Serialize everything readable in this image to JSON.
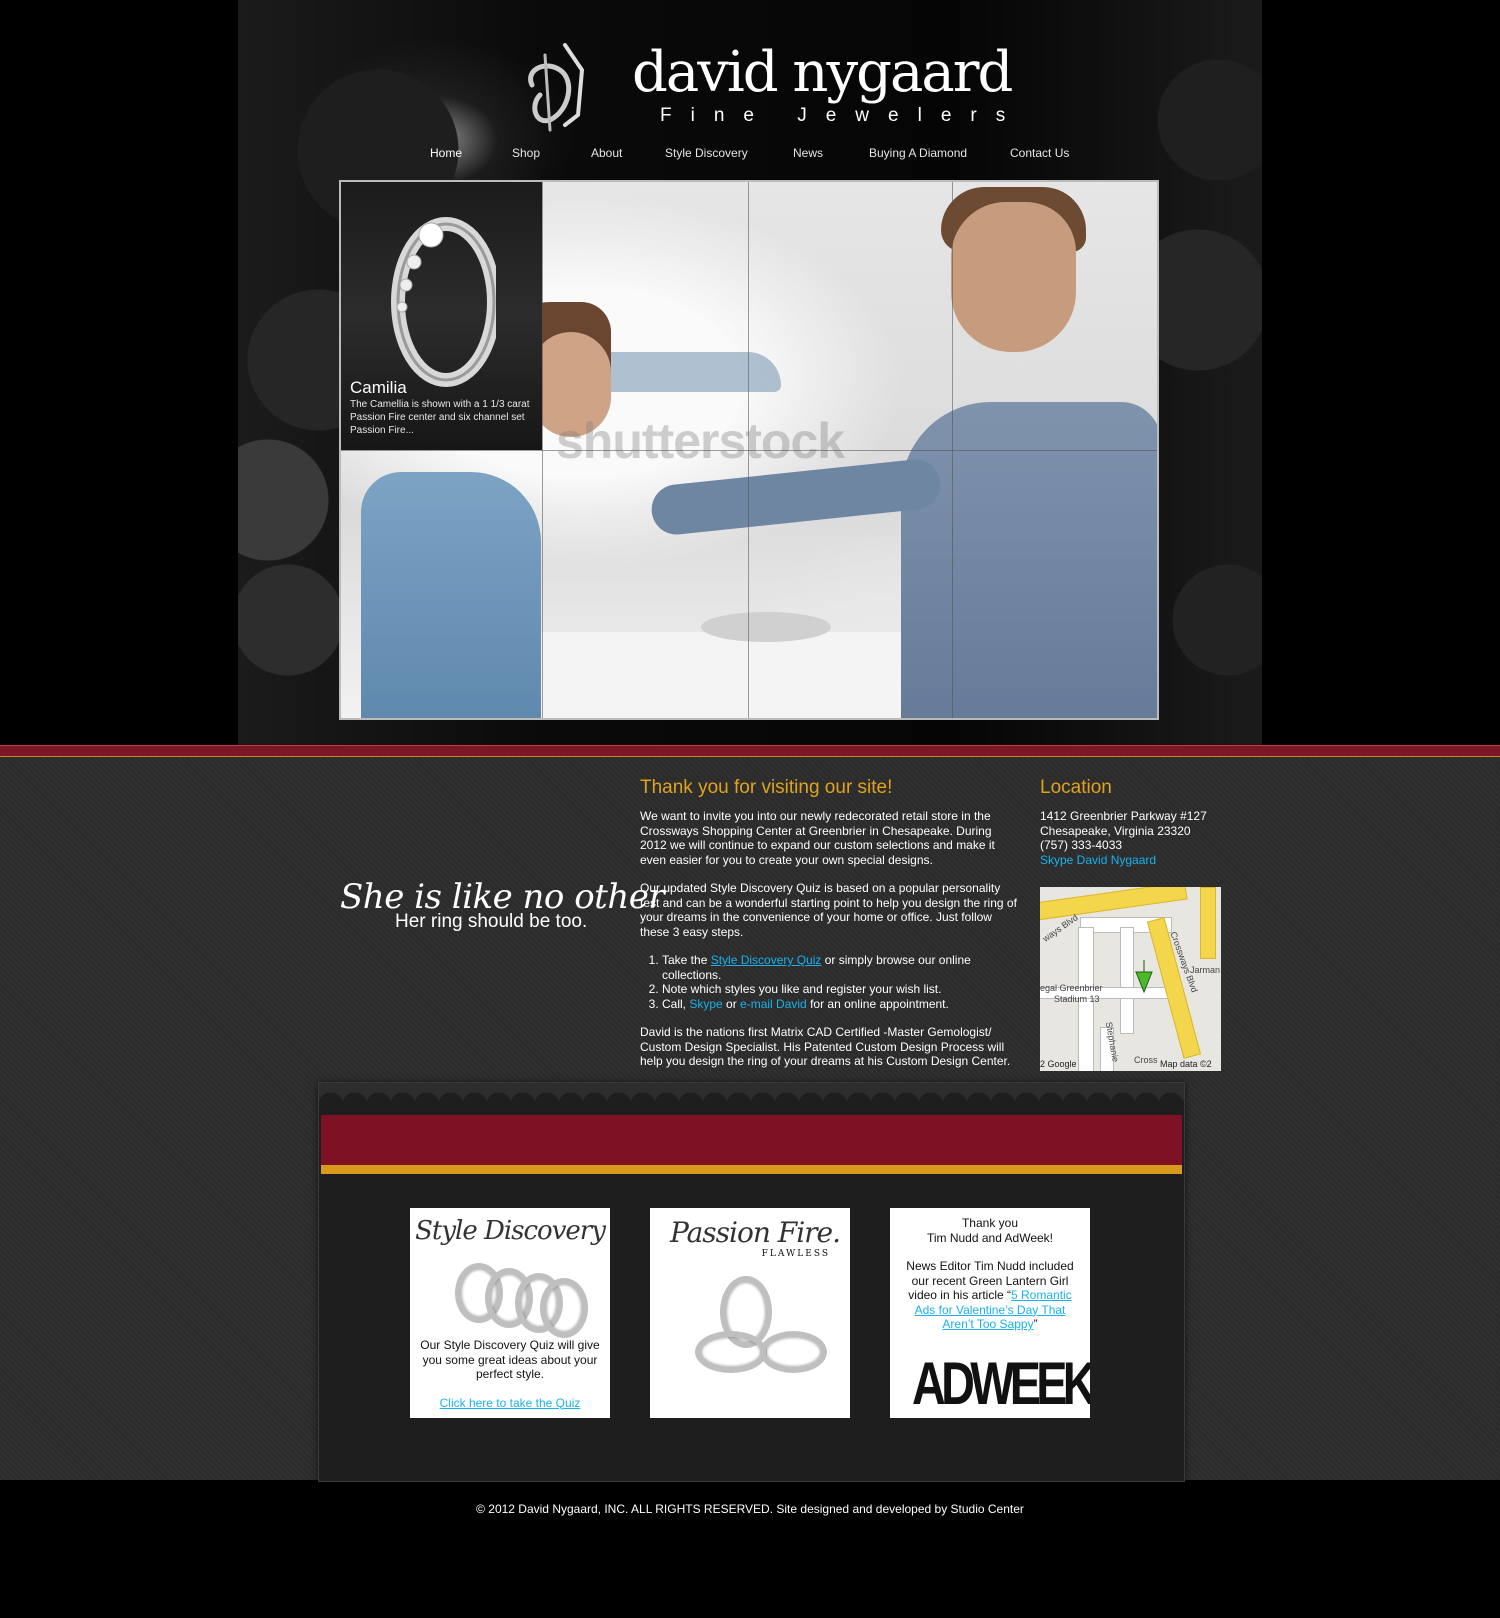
{
  "brand": {
    "name": "david nygaard",
    "subtitle": "Fine Jewelers"
  },
  "nav": {
    "items": [
      {
        "label": "Home"
      },
      {
        "label": "Shop"
      },
      {
        "label": "About"
      },
      {
        "label": "Style Discovery"
      },
      {
        "label": "News"
      },
      {
        "label": "Buying A Diamond"
      },
      {
        "label": "Contact Us"
      }
    ],
    "active": "Home"
  },
  "slideshow": {
    "watermark": "shutterstock",
    "thumb_title": "Camilia",
    "thumb_desc": "The Camellia is shown with a 1 1/3 carat Passion Fire center and six channel set Passion Fire..."
  },
  "tagline": {
    "script": "She is like no other",
    "sub": "Her ring should be too."
  },
  "welcome": {
    "heading": "Thank you for visiting our site!",
    "p1": "We want to invite you into our newly redecorated retail store in the Crossways Shopping Center at Greenbrier in Chesapeake. During 2012 we will continue to expand our custom selections and make it even easier for you to create your own special designs.",
    "p2": "Our updated Style Discovery Quiz is based on a popular personality test and can be a wonderful starting point to help you design the ring of your dreams in the convenience of your home or office. Just follow these 3 easy steps.",
    "step1_pre": "Take the ",
    "step1_link": "Style Discovery Quiz",
    "step1_post": " or simply browse our online collections.",
    "step2": "Note which styles you like and register your wish list.",
    "step3_pre": "Call, ",
    "step3_link1": "Skype",
    "step3_mid": " or ",
    "step3_link2": "e-mail David",
    "step3_post": " for an online appointment.",
    "p3": "David is the nations first Matrix CAD Certified -Master Gemologist/ Custom Design Specialist. His Patented Custom Design Process will help you design the ring of your dreams at his Custom Design Center."
  },
  "location": {
    "heading": "Location",
    "address1": "1412 Greenbrier Parkway #127",
    "address2": "Chesapeake, Virginia 23320",
    "phone": "(757) 333-4033",
    "skype_link": "Skype David Nygaard"
  },
  "map": {
    "labels": {
      "crossways_blvd_top": "ways Blvd",
      "crossways_blvd_right": "Crossways Blvd",
      "jarman": "Jarman",
      "regal": "egal Greenbrier",
      "stadium": "Stadium 13",
      "stephanie": "Stephanie",
      "cross_partial": "Cross",
      "google": "2 Google",
      "map_data": "Map data ©2"
    }
  },
  "promos": {
    "style_discovery": {
      "title": "Style Discovery",
      "text": "Our Style Discovery Quiz will give you some great ideas about your perfect style.",
      "link": "Click here to take the Quiz"
    },
    "passion_fire": {
      "title": "Passion Fire.",
      "sub": "FLAWLESS"
    },
    "adweek": {
      "line1": "Thank you",
      "line2": "Tim Nudd and AdWeek!",
      "text_pre": "News Editor Tim Nudd included our recent Green Lantern Girl video in his article “",
      "link": "5 Romantic Ads for Valentine’s Day That Aren’t Too Sappy",
      "text_post": "”",
      "logo": "ADWEEK"
    }
  },
  "footer": {
    "copyright": "© 2012 David Nygaard, INC. ALL RIGHTS RESERVED. Site designed and developed by Studio Center"
  },
  "colors": {
    "accent_gold": "#e0a31e",
    "brand_red": "#7e1123",
    "link_blue": "#1ab2ec"
  }
}
